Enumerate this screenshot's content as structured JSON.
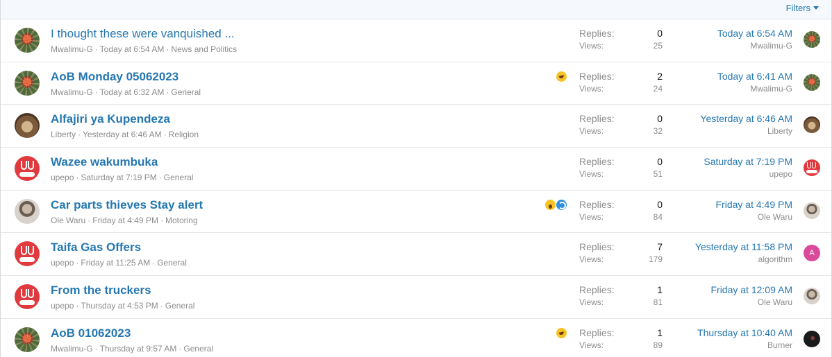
{
  "filter_bar": {
    "filters_label": "Filters"
  },
  "threads": [
    {
      "title": "I thought these were vanquished ...",
      "unread": false,
      "author": "Mwalimu-G",
      "date": "Today at 6:54 AM",
      "forum": "News and Politics",
      "avatar": "flower",
      "icons": [],
      "replies_label": "Replies:",
      "replies": "0",
      "views_label": "Views:",
      "views": "25",
      "last_date": "Today at 6:54 AM",
      "last_user": "Mwalimu-G",
      "last_avatar": "flower"
    },
    {
      "title": "AoB Monday 05062023",
      "unread": true,
      "author": "Mwalimu-G",
      "date": "Today at 6:32 AM",
      "forum": "General",
      "avatar": "flower",
      "icons": [
        "laugh"
      ],
      "replies_label": "Replies:",
      "replies": "2",
      "views_label": "Views:",
      "views": "24",
      "last_date": "Today at 6:41 AM",
      "last_user": "Mwalimu-G",
      "last_avatar": "flower"
    },
    {
      "title": "Alfajiri ya Kupendeza",
      "unread": true,
      "author": "Liberty",
      "date": "Yesterday at 6:46 AM",
      "forum": "Religion",
      "avatar": "liberty",
      "icons": [],
      "replies_label": "Replies:",
      "replies": "0",
      "views_label": "Views:",
      "views": "32",
      "last_date": "Yesterday at 6:46 AM",
      "last_user": "Liberty",
      "last_avatar": "liberty"
    },
    {
      "title": "Wazee wakumbuka",
      "unread": true,
      "author": "upepo",
      "date": "Saturday at 7:19 PM",
      "forum": "General",
      "avatar": "upepo",
      "icons": [],
      "replies_label": "Replies:",
      "replies": "0",
      "views_label": "Views:",
      "views": "51",
      "last_date": "Saturday at 7:19 PM",
      "last_user": "upepo",
      "last_avatar": "upepo"
    },
    {
      "title": "Car parts thieves Stay alert",
      "unread": true,
      "author": "Ole Waru",
      "date": "Friday at 4:49 PM",
      "forum": "Motoring",
      "avatar": "olewaru",
      "icons": [
        "wow",
        "share"
      ],
      "replies_label": "Replies:",
      "replies": "0",
      "views_label": "Views:",
      "views": "84",
      "last_date": "Friday at 4:49 PM",
      "last_user": "Ole Waru",
      "last_avatar": "olewaru"
    },
    {
      "title": "Taifa Gas Offers",
      "unread": true,
      "author": "upepo",
      "date": "Friday at 11:25 AM",
      "forum": "General",
      "avatar": "upepo",
      "icons": [],
      "replies_label": "Replies:",
      "replies": "7",
      "views_label": "Views:",
      "views": "179",
      "last_date": "Yesterday at 11:58 PM",
      "last_user": "algorithm",
      "last_avatar": "algo",
      "last_avatar_letter": "A"
    },
    {
      "title": "From the truckers",
      "unread": true,
      "author": "upepo",
      "date": "Thursday at 4:53 PM",
      "forum": "General",
      "avatar": "upepo",
      "icons": [],
      "replies_label": "Replies:",
      "replies": "1",
      "views_label": "Views:",
      "views": "81",
      "last_date": "Friday at 12:09 AM",
      "last_user": "Ole Waru",
      "last_avatar": "olewaru"
    },
    {
      "title": "AoB 01062023",
      "unread": true,
      "author": "Mwalimu-G",
      "date": "Thursday at 9:57 AM",
      "forum": "General",
      "avatar": "flower",
      "icons": [
        "laugh"
      ],
      "replies_label": "Replies:",
      "replies": "1",
      "views_label": "Views:",
      "views": "89",
      "last_date": "Thursday at 10:40 AM",
      "last_user": "Burner",
      "last_avatar": "burner"
    }
  ]
}
